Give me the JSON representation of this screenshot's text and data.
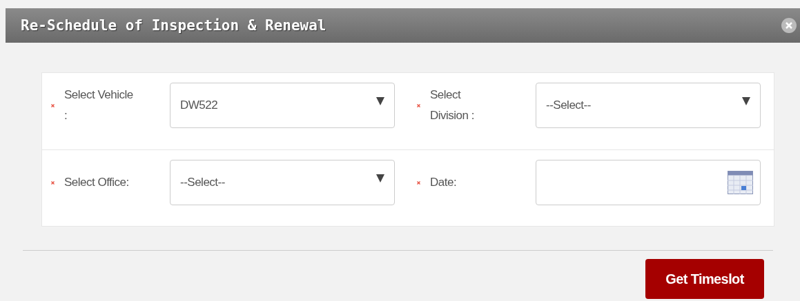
{
  "dialog": {
    "title": "Re-Schedule of Inspection & Renewal"
  },
  "fields": [
    {
      "label": "Select Vehicle :",
      "kind": "select",
      "value": "DW522",
      "required": true
    },
    {
      "label": "Select Division :",
      "kind": "select",
      "value": "--Select--",
      "required": true
    },
    {
      "label": "Select Office:",
      "kind": "select",
      "value": "--Select--",
      "required": true
    },
    {
      "label": "Date:",
      "kind": "date",
      "required": true
    }
  ],
  "submit_button": "Get Timeslot"
}
